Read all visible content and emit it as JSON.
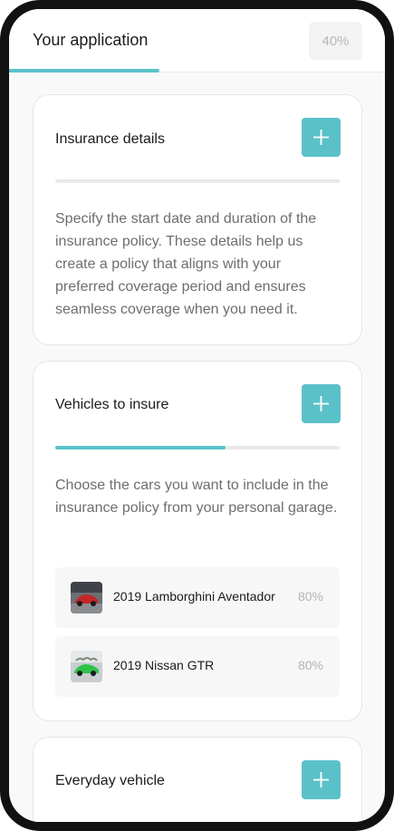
{
  "header": {
    "title": "Your application",
    "progress_label": "40%",
    "progress_fraction": 0.4
  },
  "sections": [
    {
      "title": "Insurance details",
      "progress_fraction": 0,
      "description": "Specify the start date and duration of the insurance policy. These details help us create a policy that aligns with your preferred coverage period and ensures seamless coverage when you need it."
    },
    {
      "title": "Vehicles to insure",
      "progress_fraction": 0.6,
      "description": "Choose the cars you want to include in the insurance policy from your personal garage.",
      "vehicles": [
        {
          "name": "2019 Lamborghini Aventador",
          "progress_label": "80%"
        },
        {
          "name": "2019 Nissan GTR",
          "progress_label": "80%"
        }
      ]
    },
    {
      "title": "Everyday vehicle"
    }
  ],
  "icons": {
    "add": "plus-icon"
  },
  "colors": {
    "accent": "#5bc1c9",
    "text": "#1b1b1b",
    "muted_text": "#6e6e6e",
    "track": "#e8e8e8"
  }
}
